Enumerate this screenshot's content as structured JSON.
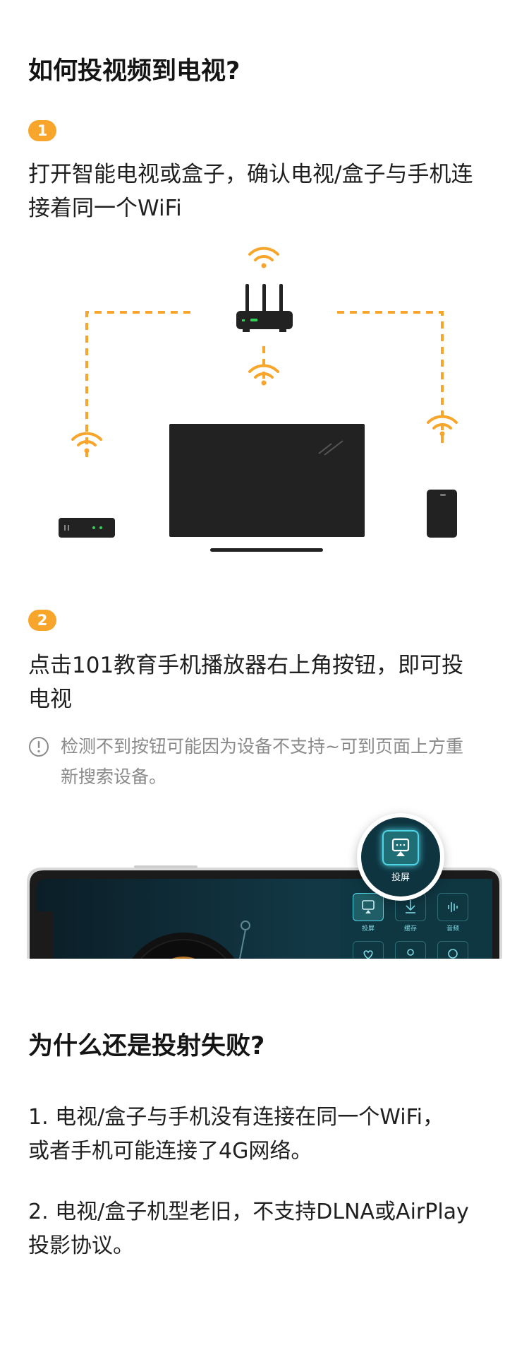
{
  "section1": {
    "title": "如何投视频到电视?",
    "step1": {
      "number": "1",
      "text_line1": "打开智能电视或盒子，确认电视/盒子与手机连",
      "text_line2": "接着同一个WiFi"
    },
    "step2": {
      "number": "2",
      "text_line1": "点击101教育手机播放器右上角按钮，即可投",
      "text_line2": "电视"
    },
    "tip": {
      "line1": "检测不到按钮可能因为设备不支持~可到页面上方重",
      "line2": "新搜索设备。"
    }
  },
  "phone_ui": {
    "cast_badge_label": "投屏",
    "tiles": [
      {
        "label": "投屏"
      },
      {
        "label": "缓存"
      },
      {
        "label": "音频"
      }
    ]
  },
  "section2": {
    "title": "为什么还是投射失败?",
    "reason1_line1": "1. 电视/盒子与手机没有连接在同一个WiFi，",
    "reason1_line2": "或者手机可能连接了4G网络。",
    "reason2_line1": "2. 电视/盒子机型老旧，不支持DLNA或AirPlay",
    "reason2_line2": "投影协议。"
  },
  "colors": {
    "accent": "#f7a52b",
    "device": "#222222",
    "led": "#2fd35a",
    "phone_screen": "#0d2a35",
    "cast_glow": "#4fd6e6"
  }
}
